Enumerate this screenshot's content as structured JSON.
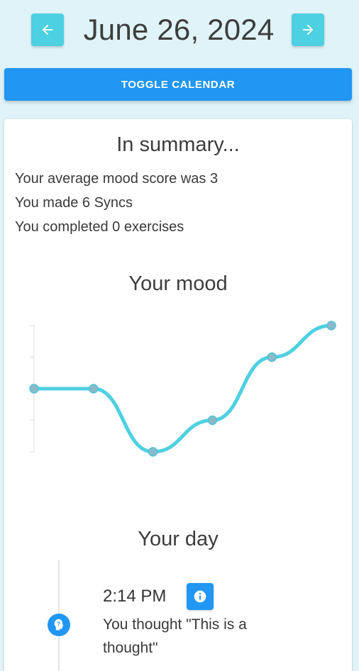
{
  "header": {
    "date": "June 26, 2024",
    "prev_icon": "arrow-left-icon",
    "next_icon": "arrow-right-icon"
  },
  "toggle_calendar_label": "TOGGLE CALENDAR",
  "summary": {
    "title": "In summary...",
    "lines": [
      "Your average mood score was 3",
      "You made 6 Syncs",
      "You completed 0 exercises"
    ]
  },
  "mood": {
    "title": "Your mood",
    "line_color": "#4dd0e1",
    "point_color": "#8ab9c8"
  },
  "chart_data": {
    "type": "line",
    "title": "",
    "xlabel": "",
    "ylabel": "",
    "x": [
      1,
      2,
      3,
      4,
      5,
      6
    ],
    "values": [
      3,
      3,
      1,
      2,
      4,
      5
    ],
    "ylim": [
      1,
      5
    ],
    "grid": false,
    "smooth": true
  },
  "day": {
    "title": "Your day",
    "entries": [
      {
        "time": "2:14 PM",
        "text": "You thought \"This is a thought\"",
        "dot_icon": "thought-head-icon",
        "action_icon": "info-icon"
      }
    ]
  },
  "colors": {
    "accent_cyan": "#4dd0e1",
    "primary_blue": "#2196f3",
    "background": "#dff3f8"
  }
}
